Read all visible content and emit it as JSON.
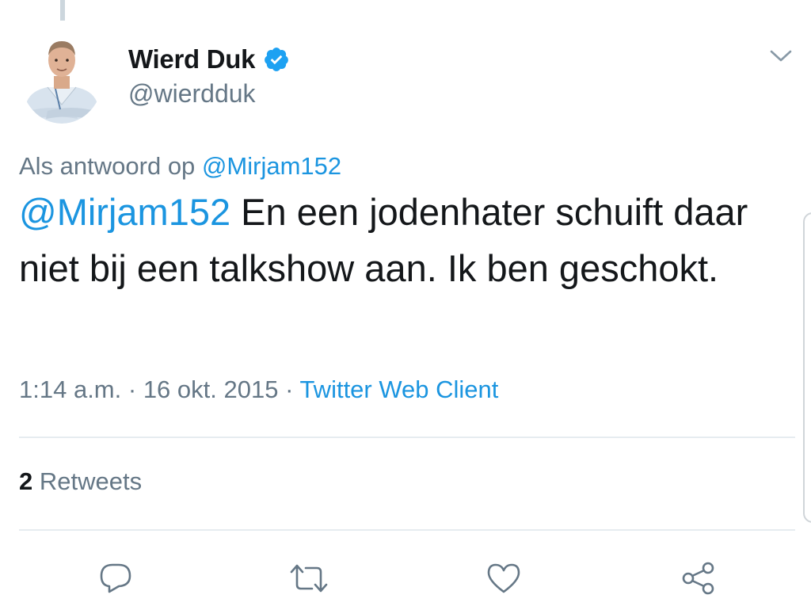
{
  "author": {
    "display_name": "Wierd Duk",
    "handle": "@wierdduk",
    "verified": true,
    "avatar_icon": "profile-photo"
  },
  "reply_context": {
    "prefix": "Als antwoord op",
    "mention": "@Mirjam152"
  },
  "tweet": {
    "mention": "@Mirjam152",
    "text": " En een jodenhater schuift daar niet bij een talkshow aan. Ik ben geschokt."
  },
  "meta": {
    "time": "1:14 a.m.",
    "separator": " · ",
    "date": "16 okt. 2015",
    "source": "Twitter Web Client"
  },
  "stats": {
    "retweet_count": "2",
    "retweet_label": "Retweets"
  },
  "actions": [
    {
      "name": "reply",
      "icon": "reply-icon"
    },
    {
      "name": "retweet",
      "icon": "retweet-icon"
    },
    {
      "name": "like",
      "icon": "heart-icon"
    },
    {
      "name": "share",
      "icon": "share-icon"
    }
  ],
  "colors": {
    "link": "#1b95e0",
    "text": "#14171a",
    "secondary": "#657786",
    "divider": "#e6ecf0",
    "verified_badge": "#1da1f2"
  }
}
